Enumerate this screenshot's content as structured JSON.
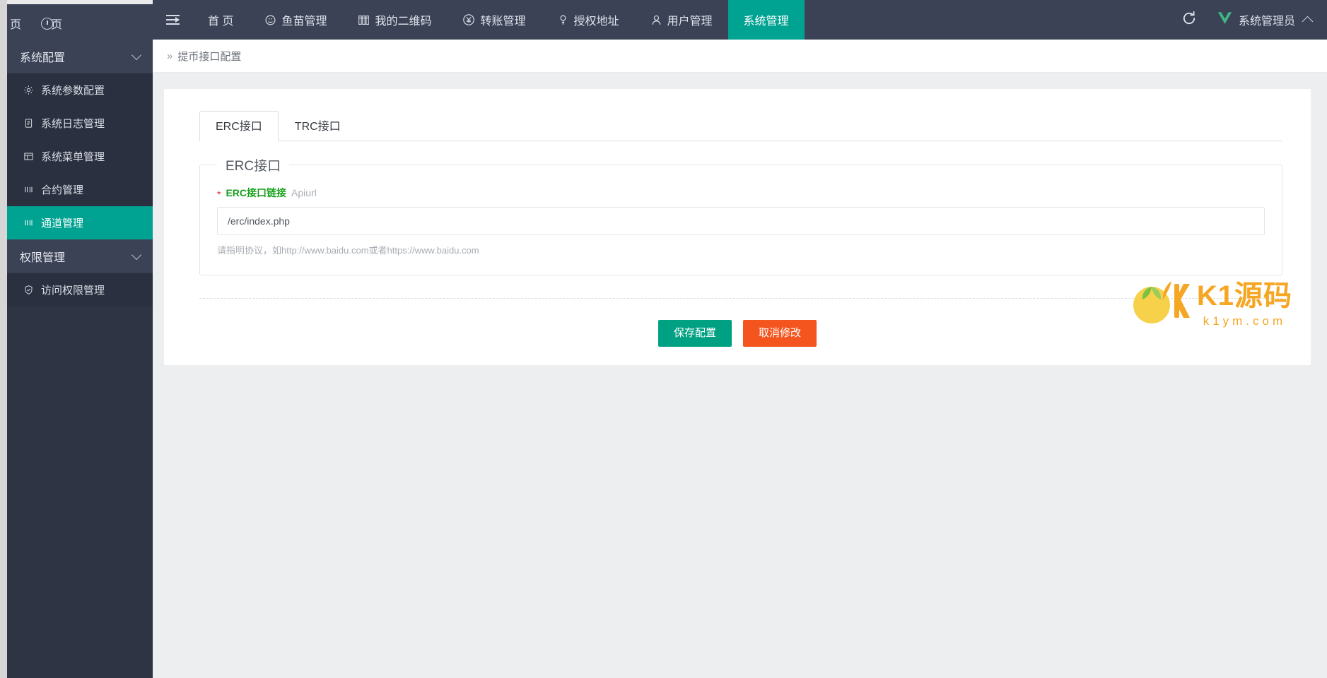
{
  "browser": {
    "tabs": [
      {
        "label": "页",
        "icon": "page-icon"
      },
      {
        "label": "页",
        "icon": "clock-icon"
      }
    ]
  },
  "topnav": {
    "menu_toggle_icon": "hamburger-icon",
    "items": [
      {
        "label": "首 页",
        "icon": "",
        "active": false
      },
      {
        "label": "鱼苗管理",
        "icon": "fish-icon",
        "active": false
      },
      {
        "label": "我的二维码",
        "icon": "qrcode-icon",
        "active": false
      },
      {
        "label": "转账管理",
        "icon": "yen-icon",
        "active": false
      },
      {
        "label": "授权地址",
        "icon": "key-icon",
        "active": false
      },
      {
        "label": "用户管理",
        "icon": "user-icon",
        "active": false
      },
      {
        "label": "系统管理",
        "icon": "",
        "active": true
      }
    ],
    "refresh_icon": "refresh-icon",
    "user": {
      "logo_icon": "vue-logo-icon",
      "name": "系统管理员",
      "caret_icon": "chevron-up-icon"
    },
    "accent_color": "#00a291",
    "bg_color": "#3b4255"
  },
  "sidebar": {
    "groups": [
      {
        "title": "系统配置",
        "expanded": true,
        "items": [
          {
            "label": "系统参数配置",
            "icon": "gear-icon",
            "active": false
          },
          {
            "label": "系统日志管理",
            "icon": "clipboard-icon",
            "active": false
          },
          {
            "label": "系统菜单管理",
            "icon": "window-icon",
            "active": false
          },
          {
            "label": "合约管理",
            "icon": "bars-icon",
            "active": false
          },
          {
            "label": "通道管理",
            "icon": "bars-icon",
            "active": true
          }
        ]
      },
      {
        "title": "权限管理",
        "expanded": true,
        "items": [
          {
            "label": "访问权限管理",
            "icon": "shield-check-icon",
            "active": false
          }
        ]
      }
    ],
    "active_color": "#00a291",
    "bg_color": "#2f3445"
  },
  "breadcrumb": {
    "arrow": "»",
    "title": "提币接口配置"
  },
  "main": {
    "tabs": [
      {
        "label": "ERC接口",
        "active": true
      },
      {
        "label": "TRC接口",
        "active": false
      }
    ],
    "fieldset": {
      "legend": "ERC接口",
      "field": {
        "required_mark": "*",
        "label": "ERC接口链接",
        "sub_label": "Apiurl",
        "value": "/erc/index.php",
        "placeholder": "",
        "hint": "请指明协议，如http://www.baidu.com或者https://www.baidu.com"
      }
    },
    "buttons": {
      "save": "保存配置",
      "cancel": "取消修改",
      "save_color": "#00a082",
      "cancel_color": "#f4551e"
    }
  },
  "watermark": {
    "main": "K1源码",
    "sub": "k1ym.com",
    "color": "#f5a623"
  }
}
